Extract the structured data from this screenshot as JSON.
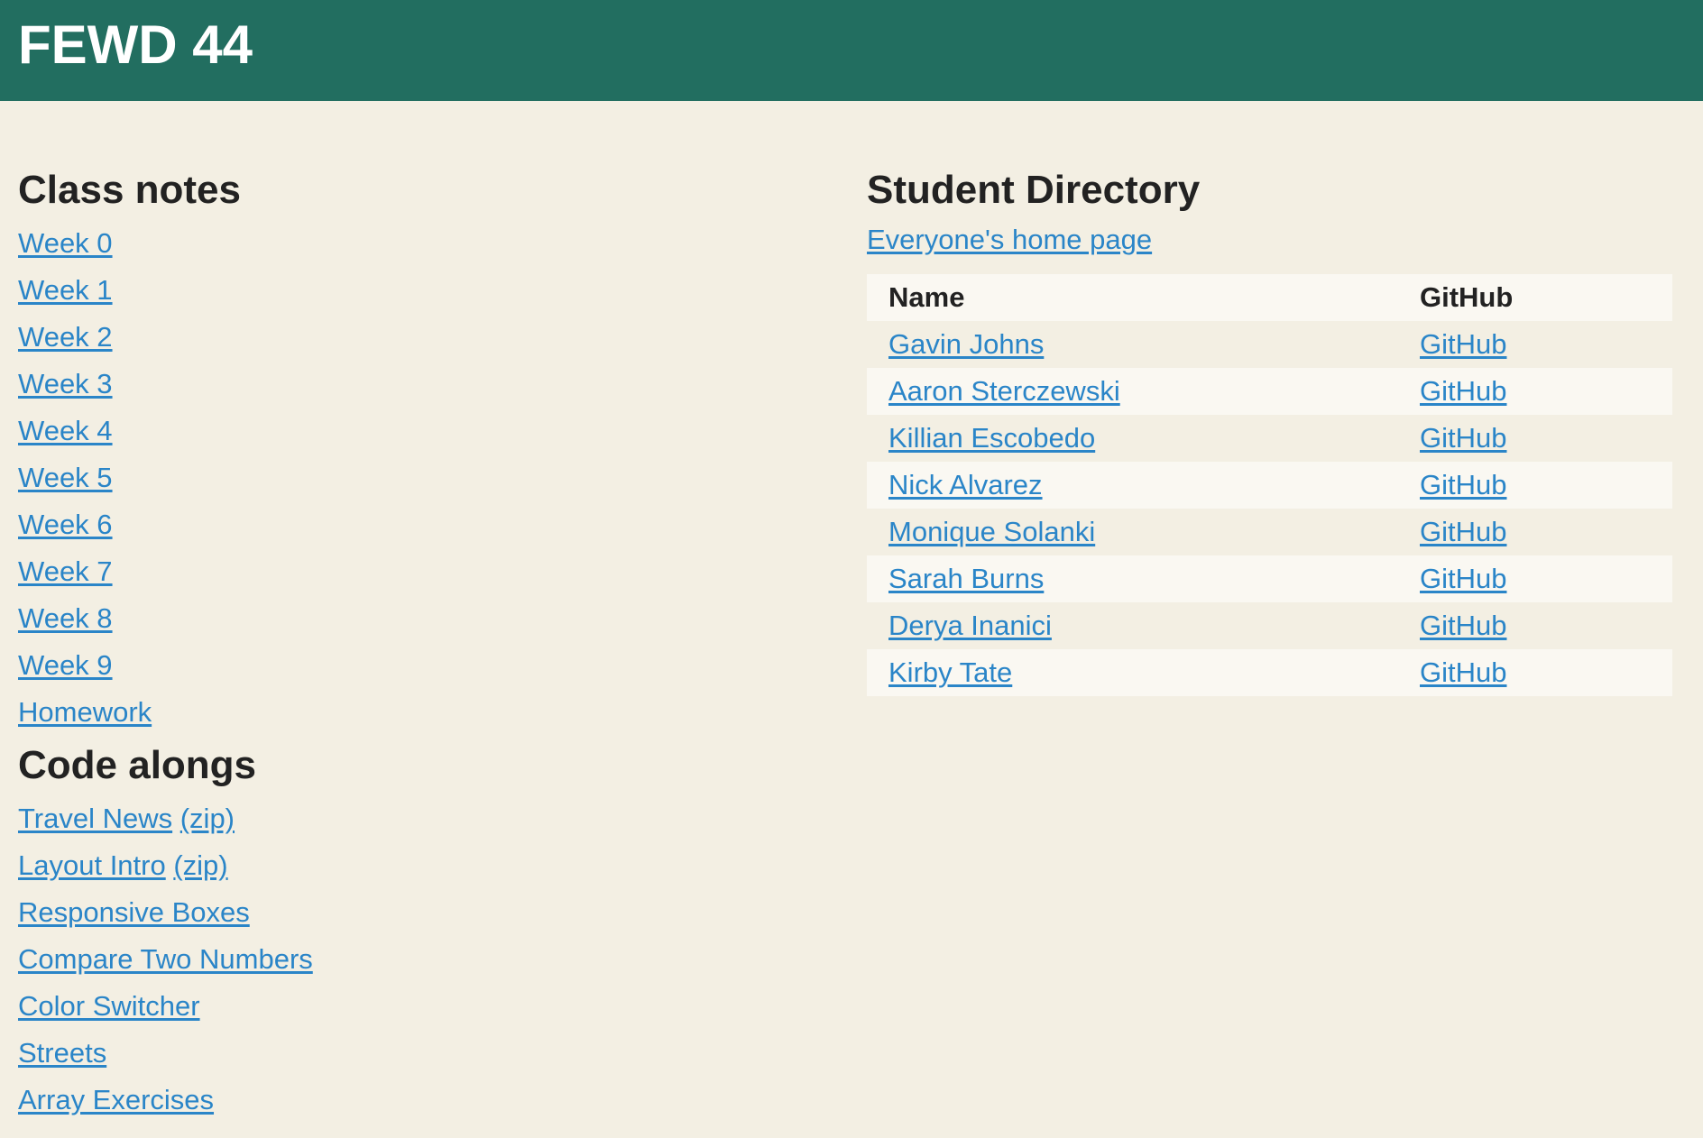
{
  "header": {
    "title": "FEWD 44"
  },
  "class_notes": {
    "heading": "Class notes",
    "links": [
      "Week 0",
      "Week 1",
      "Week 2",
      "Week 3",
      "Week 4",
      "Week 5",
      "Week 6",
      "Week 7",
      "Week 8",
      "Week 9",
      "Homework"
    ]
  },
  "code_alongs": {
    "heading": "Code alongs",
    "items": [
      {
        "label": "Travel News",
        "zip": "(zip)"
      },
      {
        "label": "Layout Intro",
        "zip": "(zip)"
      },
      {
        "label": "Responsive Boxes"
      },
      {
        "label": "Compare Two Numbers"
      },
      {
        "label": "Color Switcher"
      },
      {
        "label": "Streets"
      },
      {
        "label": "Array Exercises"
      }
    ]
  },
  "student_directory": {
    "heading": "Student Directory",
    "home_link": "Everyone's home page",
    "columns": [
      "Name",
      "GitHub"
    ],
    "rows": [
      {
        "name": "Gavin Johns",
        "github": "GitHub"
      },
      {
        "name": "Aaron Sterczewski",
        "github": "GitHub"
      },
      {
        "name": "Killian Escobedo",
        "github": "GitHub"
      },
      {
        "name": "Nick Alvarez",
        "github": "GitHub"
      },
      {
        "name": "Monique Solanki",
        "github": "GitHub"
      },
      {
        "name": "Sarah Burns",
        "github": "GitHub"
      },
      {
        "name": "Derya Inanici",
        "github": "GitHub"
      },
      {
        "name": "Kirby Tate",
        "github": "GitHub"
      }
    ]
  },
  "colors": {
    "header_bg": "#226e60",
    "page_bg": "#f3efe3",
    "link": "#2a85c8",
    "stripe": "#faf8f2"
  }
}
